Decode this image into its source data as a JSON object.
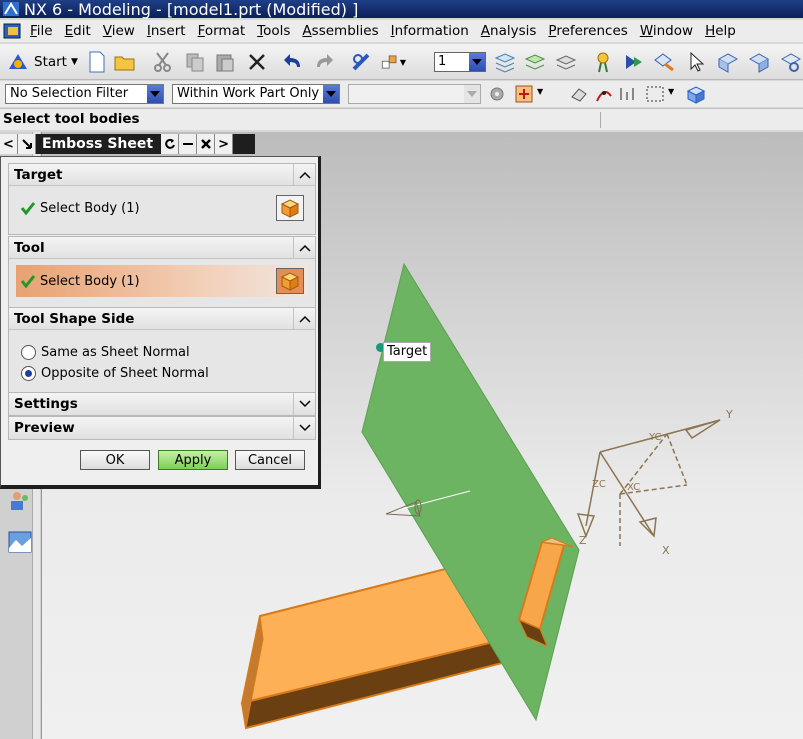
{
  "window": {
    "title": "NX 6 - Modeling - [model1.prt (Modified) ]"
  },
  "menu": {
    "items": [
      {
        "label": "File",
        "u": "F",
        "rest": "ile"
      },
      {
        "label": "Edit",
        "u": "E",
        "rest": "dit"
      },
      {
        "label": "View",
        "u": "V",
        "rest": "iew"
      },
      {
        "label": "Insert",
        "u": "I",
        "rest": "nsert"
      },
      {
        "label": "Format",
        "u": "F",
        "rest": "ormat"
      },
      {
        "label": "Tools",
        "u": "T",
        "rest": "ools"
      },
      {
        "label": "Assemblies",
        "u": "A",
        "rest": "ssemblies"
      },
      {
        "label": "Information",
        "u": "I",
        "rest": "nformation"
      },
      {
        "label": "Analysis",
        "u": "A",
        "rest": "nalysis"
      },
      {
        "label": "Preferences",
        "u": "P",
        "rest": "references"
      },
      {
        "label": "Window",
        "u": "W",
        "rest": "indow"
      },
      {
        "label": "Help",
        "u": "H",
        "rest": "elp"
      }
    ]
  },
  "toolbar": {
    "start_label": "Start",
    "layer_value": "1"
  },
  "selection_bar": {
    "filter": "No Selection Filter",
    "scope": "Within Work Part Only",
    "third": ""
  },
  "cue": {
    "text": "Select tool bodies"
  },
  "dialog": {
    "title": "Emboss Sheet",
    "target_group": "Target",
    "target_select": "Select Body (1)",
    "tool_group": "Tool",
    "tool_select": "Select Body (1)",
    "shape_group": "Tool Shape Side",
    "radio_same": "Same as Sheet Normal",
    "radio_opposite": "Opposite of Sheet Normal",
    "settings_group": "Settings",
    "preview_group": "Preview",
    "ok": "OK",
    "apply": "Apply",
    "cancel": "Cancel"
  },
  "viewport": {
    "target_tag": "Target",
    "axes": {
      "x": "X",
      "y": "Y",
      "z": "Z",
      "xc": "XC",
      "yc": "YC",
      "zc": "ZC"
    },
    "colors": {
      "sheet": "#6db462",
      "block": "#fdb055",
      "block_side": "#6a3f12"
    }
  }
}
